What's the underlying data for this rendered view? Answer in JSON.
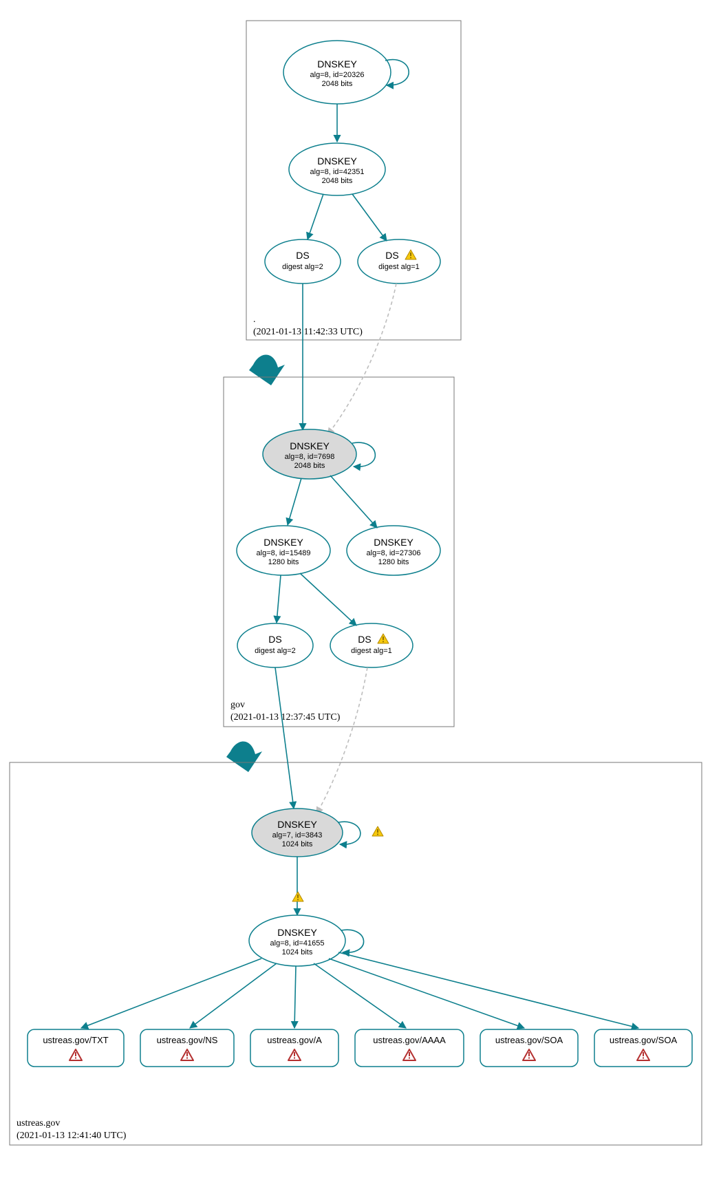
{
  "colors": {
    "accent": "#0d7f8d",
    "node_fill": "#d9d9d9",
    "warn": "#f6c90e",
    "error_stroke": "#b43030"
  },
  "zones": {
    "root": {
      "label": ".",
      "timestamp": "(2021-01-13 11:42:33 UTC)"
    },
    "gov": {
      "label": "gov",
      "timestamp": "(2021-01-13 12:37:45 UTC)"
    },
    "ustreas": {
      "label": "ustreas.gov",
      "timestamp": "(2021-01-13 12:41:40 UTC)"
    }
  },
  "nodes": {
    "root_ksk": {
      "title": "DNSKEY",
      "line2": "alg=8, id=20326",
      "line3": "2048 bits"
    },
    "root_zsk": {
      "title": "DNSKEY",
      "line2": "alg=8, id=42351",
      "line3": "2048 bits"
    },
    "root_ds2": {
      "title": "DS",
      "line2": "digest alg=2"
    },
    "root_ds1": {
      "title": "DS",
      "line2": "digest alg=1"
    },
    "gov_ksk": {
      "title": "DNSKEY",
      "line2": "alg=8, id=7698",
      "line3": "2048 bits"
    },
    "gov_zsk1": {
      "title": "DNSKEY",
      "line2": "alg=8, id=15489",
      "line3": "1280 bits"
    },
    "gov_zsk2": {
      "title": "DNSKEY",
      "line2": "alg=8, id=27306",
      "line3": "1280 bits"
    },
    "gov_ds2": {
      "title": "DS",
      "line2": "digest alg=2"
    },
    "gov_ds1": {
      "title": "DS",
      "line2": "digest alg=1"
    },
    "ust_ksk": {
      "title": "DNSKEY",
      "line2": "alg=7, id=3843",
      "line3": "1024 bits"
    },
    "ust_zsk": {
      "title": "DNSKEY",
      "line2": "alg=8, id=41655",
      "line3": "1024 bits"
    }
  },
  "rrsets": {
    "r0": "ustreas.gov/TXT",
    "r1": "ustreas.gov/NS",
    "r2": "ustreas.gov/A",
    "r3": "ustreas.gov/AAAA",
    "r4": "ustreas.gov/SOA",
    "r5": "ustreas.gov/SOA"
  },
  "icons": {
    "warn": "warning-icon",
    "error": "error-icon"
  }
}
